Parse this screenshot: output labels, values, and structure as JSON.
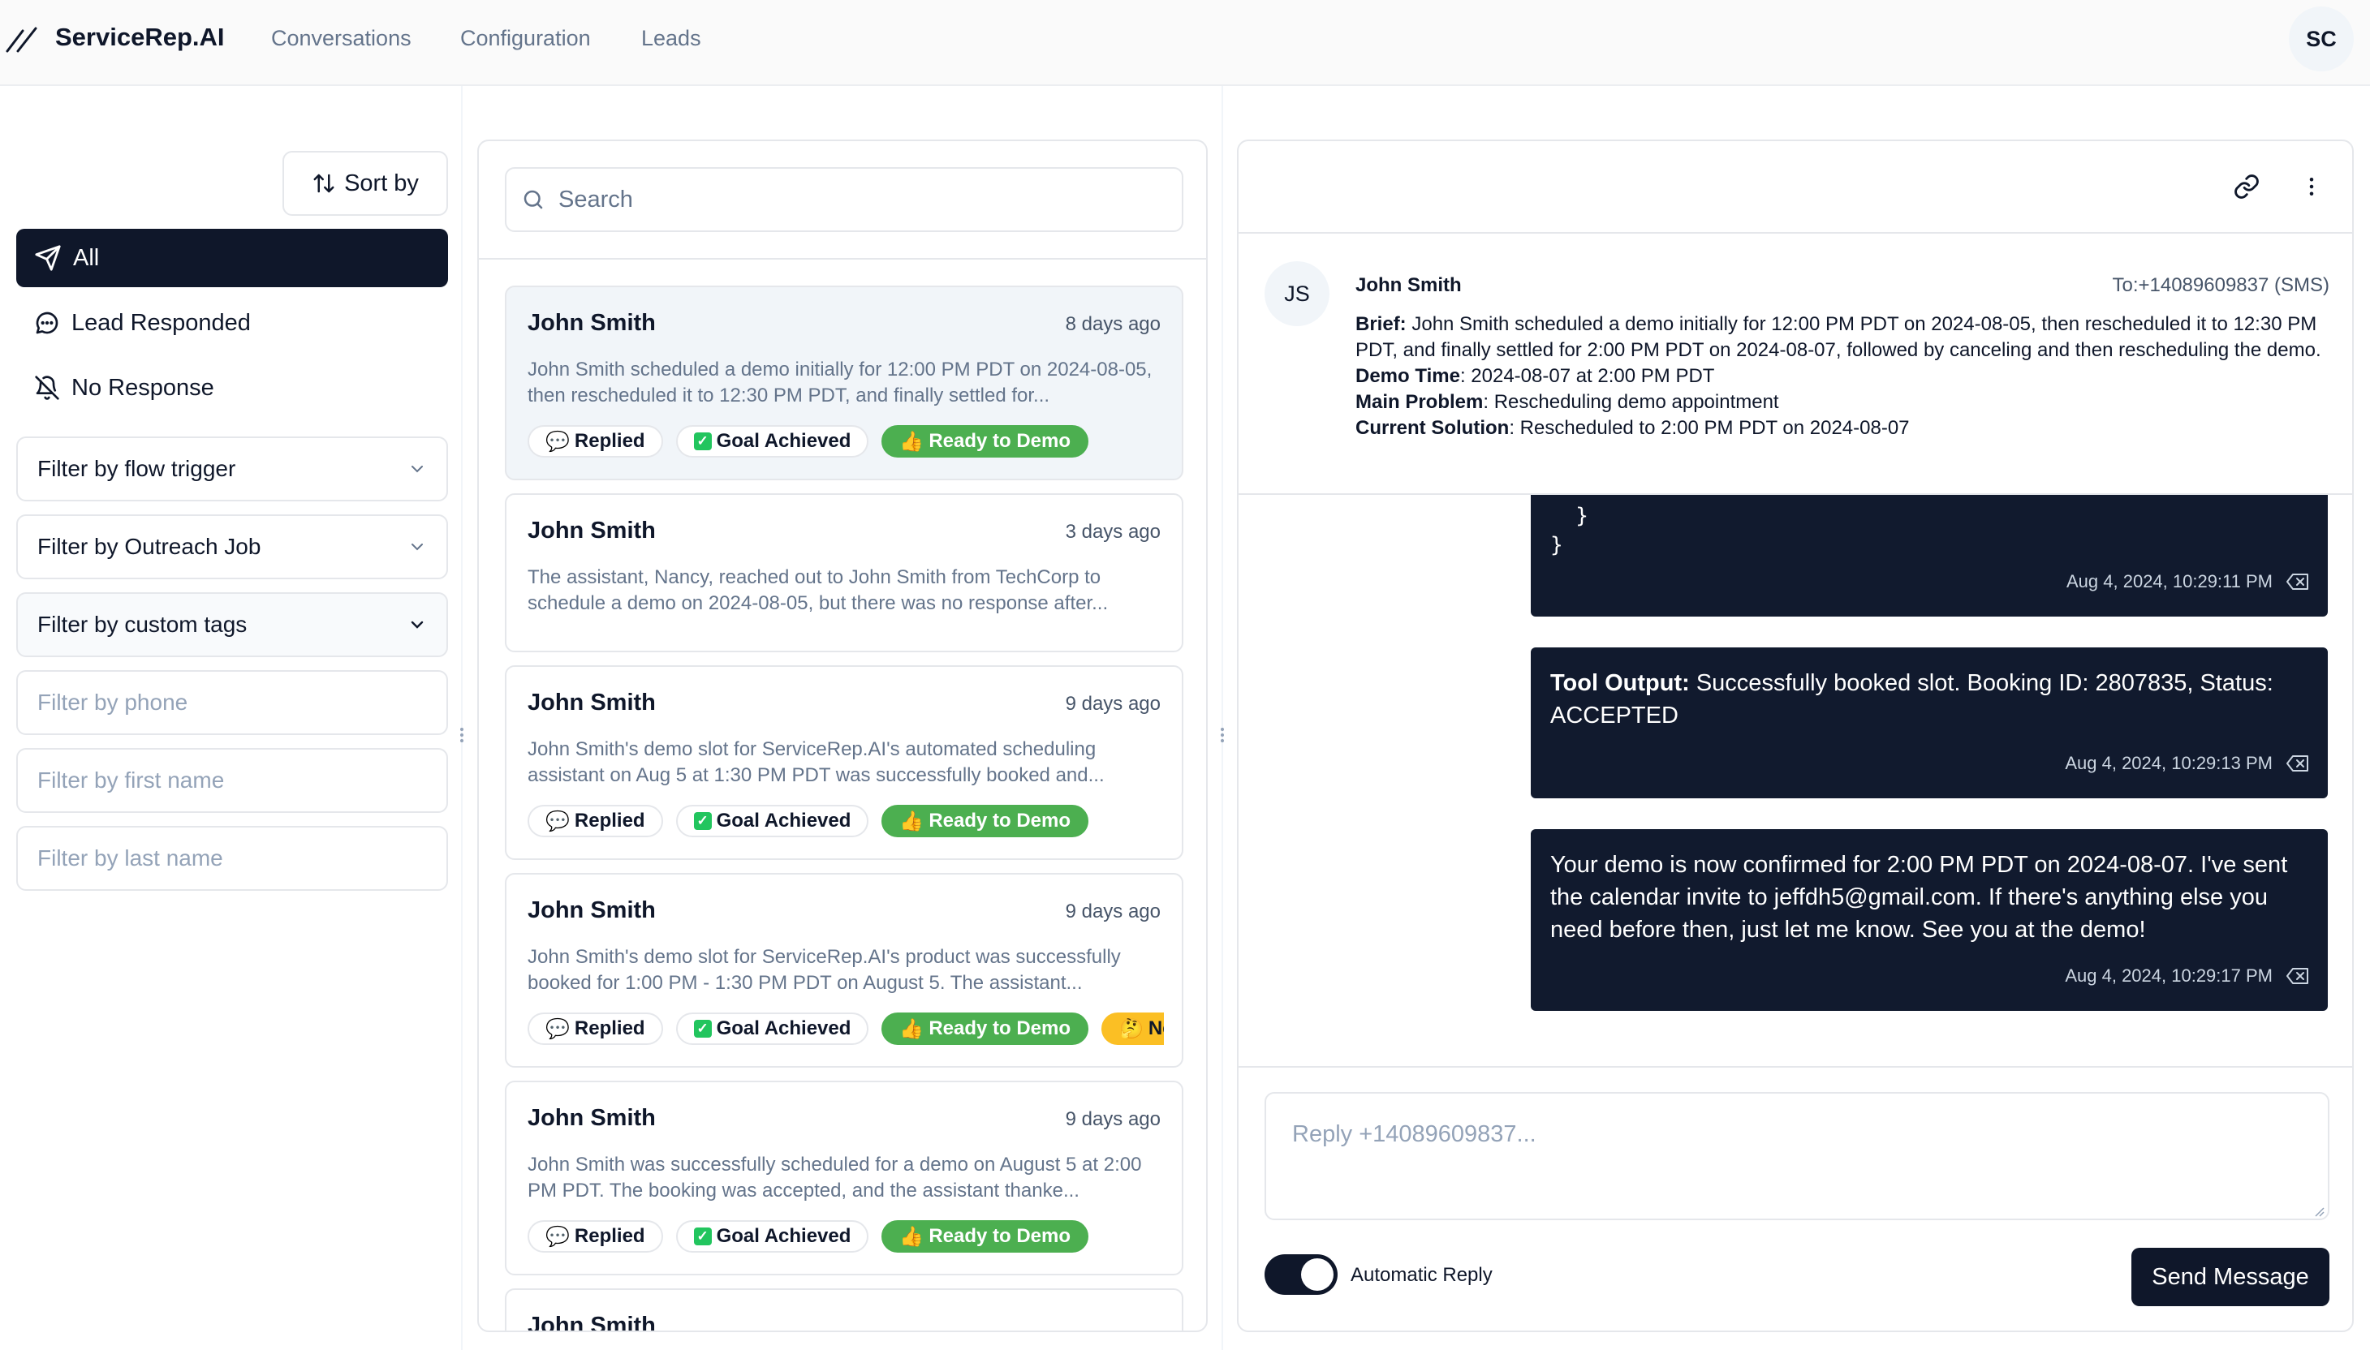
{
  "app": {
    "brand": "ServiceRep.AI",
    "nav": [
      "Conversations",
      "Configuration",
      "Leads"
    ],
    "user_initials": "SC"
  },
  "sidebar": {
    "sort_label": "Sort by",
    "categories": [
      {
        "label": "All",
        "icon": "send-icon",
        "active": true
      },
      {
        "label": "Lead Responded",
        "icon": "message-dots-icon",
        "active": false
      },
      {
        "label": "No Response",
        "icon": "bell-off-icon",
        "active": false
      }
    ],
    "selects": [
      {
        "label": "Filter by flow trigger"
      },
      {
        "label": "Filter by Outreach Job"
      },
      {
        "label": "Filter by custom tags"
      }
    ],
    "inputs": [
      {
        "placeholder": "Filter by phone"
      },
      {
        "placeholder": "Filter by first name"
      },
      {
        "placeholder": "Filter by last name"
      }
    ]
  },
  "list": {
    "search_placeholder": "Search",
    "conversations": [
      {
        "name": "John Smith",
        "time": "8 days ago",
        "preview": "John Smith scheduled a demo initially for 12:00 PM PDT on 2024-08-05, then rescheduled it to 12:30 PM PDT, and finally settled for...",
        "selected": true,
        "tags": [
          "Replied",
          "Goal Achieved",
          "Ready to Demo"
        ]
      },
      {
        "name": "John Smith",
        "time": "3 days ago",
        "preview": "The assistant, Nancy, reached out to John Smith from TechCorp to schedule a demo on 2024-08-05, but there was no response after...",
        "selected": false,
        "tags": []
      },
      {
        "name": "John Smith",
        "time": "9 days ago",
        "preview": "John Smith's demo slot for ServiceRep.AI's automated scheduling assistant on Aug 5 at 1:30 PM PDT was successfully booked and...",
        "selected": false,
        "tags": [
          "Replied",
          "Goal Achieved",
          "Ready to Demo"
        ]
      },
      {
        "name": "John Smith",
        "time": "9 days ago",
        "preview": "John Smith's demo slot for ServiceRep.AI's product was successfully booked for 1:00 PM - 1:30 PM PDT on August 5. The assistant...",
        "selected": false,
        "tags": [
          "Replied",
          "Goal Achieved",
          "Ready to Demo",
          "Ne"
        ]
      },
      {
        "name": "John Smith",
        "time": "9 days ago",
        "preview": "John Smith was successfully scheduled for a demo on August 5 at 2:00 PM PDT. The booking was accepted, and the assistant thanke...",
        "selected": false,
        "tags": [
          "Replied",
          "Goal Achieved",
          "Ready to Demo"
        ]
      },
      {
        "name": "John Smith",
        "time": "",
        "preview": "",
        "selected": false,
        "tags": []
      }
    ]
  },
  "detail": {
    "avatar_initials": "JS",
    "name": "John Smith",
    "to": "To:+14089609837 (SMS)",
    "brief": [
      {
        "label": "Brief:",
        "text": " John Smith scheduled a demo initially for 12:00 PM PDT on 2024-08-05, then rescheduled it to 12:30 PM PDT, and finally settled for 2:00 PM PDT on 2024-08-07, followed by canceling and then rescheduling the demo."
      },
      {
        "label": "Demo Time",
        "text": ": 2024-08-07 at 2:00 PM PDT"
      },
      {
        "label": "Main Problem",
        "text": ": Rescheduling demo appointment"
      },
      {
        "label": "Current Solution",
        "text": ": Rescheduled to 2:00 PM PDT on 2024-08-07"
      }
    ],
    "messages": [
      {
        "code_lines": [
          "  }",
          "}"
        ],
        "time": "Aug 4, 2024, 10:29:11 PM"
      },
      {
        "bold": "Tool Output:",
        "text": " Successfully booked slot. Booking ID: 2807835, Status: ACCEPTED",
        "time": "Aug 4, 2024, 10:29:13 PM"
      },
      {
        "bold": "",
        "text": "Your demo is now confirmed for 2:00 PM PDT on 2024-08-07. I've sent the calendar invite to jeffdh5@gmail.com. If there's anything else you need before then, just let me know. See you at the demo!",
        "time": "Aug 4, 2024, 10:29:17 PM"
      }
    ],
    "reply_placeholder": "Reply +14089609837...",
    "auto_reply_label": "Automatic Reply",
    "auto_reply_on": true,
    "send_label": "Send Message"
  }
}
